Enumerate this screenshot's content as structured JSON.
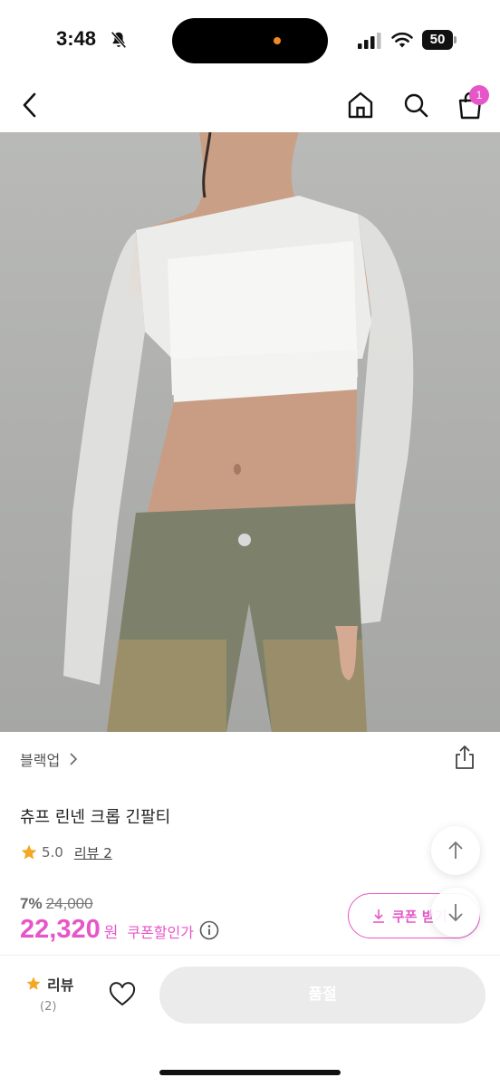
{
  "status_bar": {
    "time": "3:48",
    "battery": "50"
  },
  "nav": {
    "cart_count": "1"
  },
  "product": {
    "brand": "블랙업",
    "title": "츄프 린넨 크롭 긴팔티",
    "rating": "5.0",
    "review_link": "리뷰 2",
    "discount_rate": "7%",
    "original_price": "24,000",
    "sale_price": "22,320",
    "price_unit": "원",
    "coupon_price_label": "쿠폰할인가",
    "coupon_button_label": "쿠폰 받기"
  },
  "bottom_bar": {
    "review_label": "리뷰",
    "review_count": "(2)",
    "soldout_label": "품절"
  },
  "colors": {
    "accent": "#e756c8",
    "star": "#f5a623",
    "soldout_bg": "#ebebeb"
  },
  "icons": [
    "back-icon",
    "home-icon",
    "search-icon",
    "cart-icon",
    "share-icon",
    "star-icon",
    "info-icon",
    "download-icon",
    "arrow-up-icon",
    "arrow-down-icon",
    "heart-icon",
    "bell-off-icon",
    "signal-icon",
    "wifi-icon",
    "battery-icon"
  ]
}
